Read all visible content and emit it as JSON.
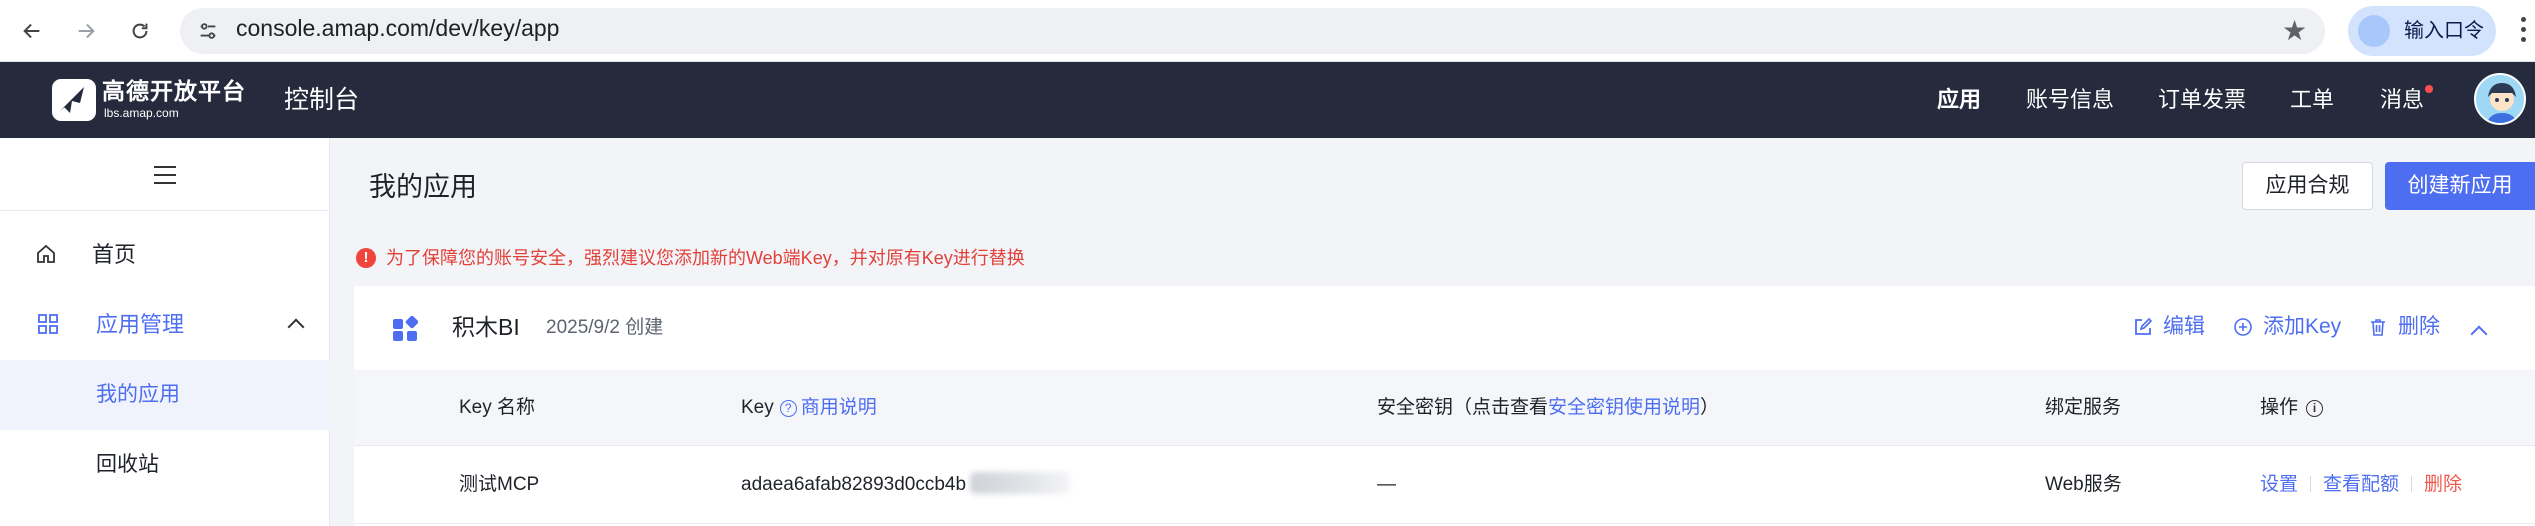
{
  "browser": {
    "url": "console.amap.com/dev/key/app",
    "profile_label": "输入口令"
  },
  "header": {
    "logo_title": "高德开放平台",
    "logo_subtitle": "lbs.amap.com",
    "console_title": "控制台",
    "nav": [
      "应用",
      "账号信息",
      "订单发票",
      "工单",
      "消息"
    ]
  },
  "sidebar": {
    "home": "首页",
    "app_management": "应用管理",
    "my_apps": "我的应用",
    "recycle_bin": "回收站"
  },
  "main": {
    "title": "我的应用",
    "compliance_button": "应用合规",
    "create_button": "创建新应用",
    "alert": "为了保障您的账号安全，强烈建议您添加新的Web端Key，并对原有Key进行替换"
  },
  "app_card": {
    "name": "积木BI",
    "created": "2025/9/2 创建",
    "actions": {
      "edit": "编辑",
      "add_key": "添加Key",
      "delete": "删除"
    },
    "table": {
      "headers": {
        "key_name": "Key 名称",
        "key": "Key",
        "key_help_link": "商用说明",
        "secret_prefix": "安全密钥（点击查看",
        "secret_link": "安全密钥使用说明",
        "secret_suffix": "）",
        "service": "绑定服务",
        "ops": "操作"
      },
      "rows": [
        {
          "key_name": "测试MCP",
          "key": "adaea6afab82893d0ccb4b",
          "secret": "—",
          "service": "Web服务",
          "ops": [
            "设置",
            "查看配额",
            "删除"
          ]
        }
      ]
    }
  },
  "colors": {
    "header_bg": "#252a3c",
    "primary": "#4e6ef2",
    "danger": "#f05a4f",
    "alert": "#e2413a"
  }
}
